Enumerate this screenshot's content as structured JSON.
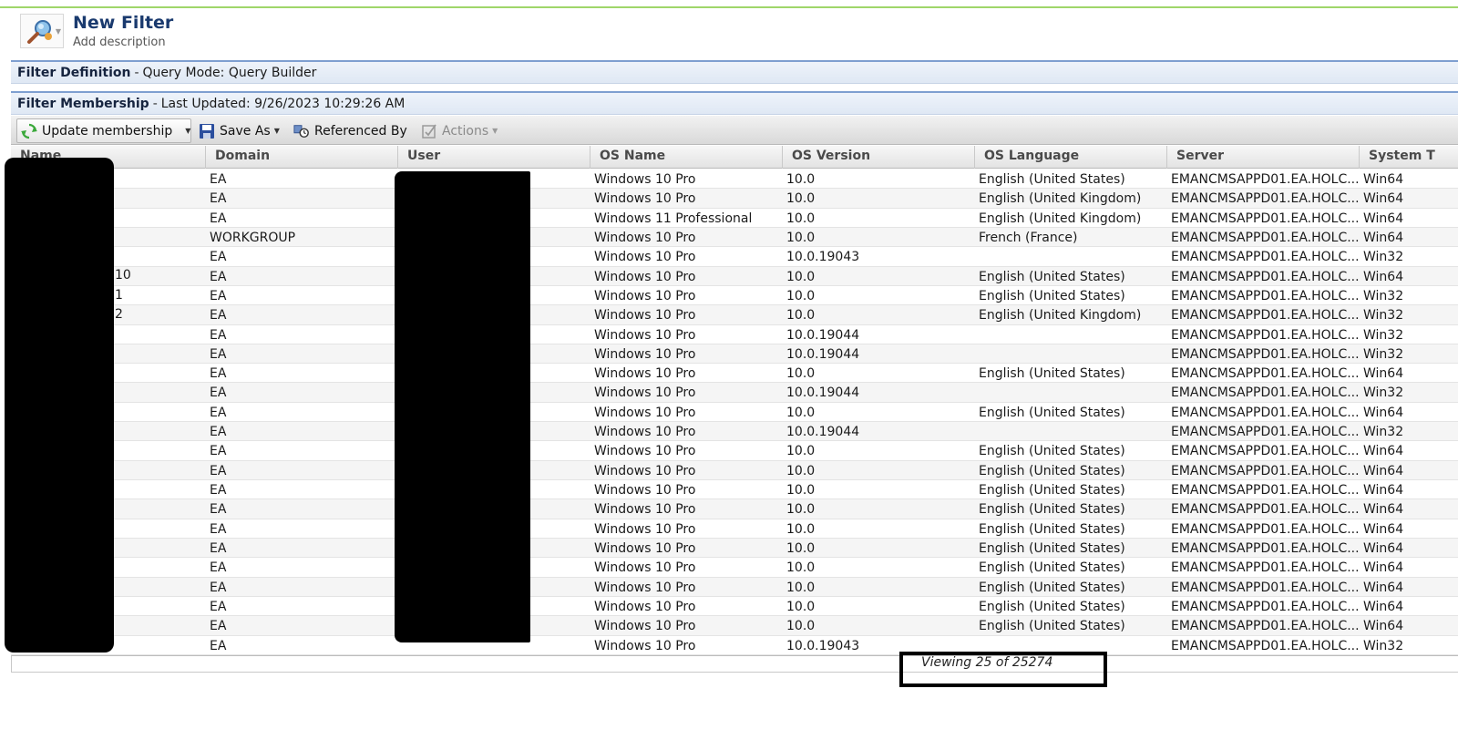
{
  "header": {
    "title": "New Filter",
    "subtitle": "Add description"
  },
  "definition_bar": {
    "label": "Filter Definition",
    "separator": "-",
    "detail": "Query Mode: Query Builder"
  },
  "membership_bar": {
    "label": "Filter Membership",
    "separator": "-",
    "detail": "Last Updated: 9/26/2023 10:29:26 AM"
  },
  "toolbar": {
    "update_label": "Update membership",
    "save_as_label": "Save As",
    "referenced_by_label": "Referenced By",
    "actions_label": "Actions"
  },
  "columns": [
    "Name",
    "Domain",
    "User",
    "OS Name",
    "OS Version",
    "OS Language",
    "Server",
    "System T"
  ],
  "name_fragments": [
    "10",
    "1",
    "2"
  ],
  "rows": [
    {
      "domain": "EA",
      "os_name": "Windows 10 Pro",
      "os_version": "10.0",
      "os_language": "English (United States)",
      "server": "EMANCMSAPPD01.EA.HOLC...",
      "system_type": "Win64"
    },
    {
      "domain": "EA",
      "os_name": "Windows 10 Pro",
      "os_version": "10.0",
      "os_language": "English (United Kingdom)",
      "server": "EMANCMSAPPD01.EA.HOLC...",
      "system_type": "Win64"
    },
    {
      "domain": "EA",
      "os_name": "Windows 11 Professional",
      "os_version": "10.0",
      "os_language": "English (United Kingdom)",
      "server": "EMANCMSAPPD01.EA.HOLC...",
      "system_type": "Win64"
    },
    {
      "domain": "WORKGROUP",
      "os_name": "Windows 10 Pro",
      "os_version": "10.0",
      "os_language": "French (France)",
      "server": "EMANCMSAPPD01.EA.HOLC...",
      "system_type": "Win64"
    },
    {
      "domain": "EA",
      "os_name": "Windows 10 Pro",
      "os_version": "10.0.19043",
      "os_language": "",
      "server": "EMANCMSAPPD01.EA.HOLC...",
      "system_type": "Win32"
    },
    {
      "domain": "EA",
      "os_name": "Windows 10 Pro",
      "os_version": "10.0",
      "os_language": "English (United States)",
      "server": "EMANCMSAPPD01.EA.HOLC...",
      "system_type": "Win64"
    },
    {
      "domain": "EA",
      "os_name": "Windows 10 Pro",
      "os_version": "10.0",
      "os_language": "English (United States)",
      "server": "EMANCMSAPPD01.EA.HOLC...",
      "system_type": "Win32"
    },
    {
      "domain": "EA",
      "os_name": "Windows 10 Pro",
      "os_version": "10.0",
      "os_language": "English (United Kingdom)",
      "server": "EMANCMSAPPD01.EA.HOLC...",
      "system_type": "Win32"
    },
    {
      "domain": "EA",
      "os_name": "Windows 10 Pro",
      "os_version": "10.0.19044",
      "os_language": "",
      "server": "EMANCMSAPPD01.EA.HOLC...",
      "system_type": "Win32"
    },
    {
      "domain": "EA",
      "os_name": "Windows 10 Pro",
      "os_version": "10.0.19044",
      "os_language": "",
      "server": "EMANCMSAPPD01.EA.HOLC...",
      "system_type": "Win32"
    },
    {
      "domain": "EA",
      "os_name": "Windows 10 Pro",
      "os_version": "10.0",
      "os_language": "English (United States)",
      "server": "EMANCMSAPPD01.EA.HOLC...",
      "system_type": "Win64"
    },
    {
      "domain": "EA",
      "os_name": "Windows 10 Pro",
      "os_version": "10.0.19044",
      "os_language": "",
      "server": "EMANCMSAPPD01.EA.HOLC...",
      "system_type": "Win32"
    },
    {
      "domain": "EA",
      "os_name": "Windows 10 Pro",
      "os_version": "10.0",
      "os_language": "English (United States)",
      "server": "EMANCMSAPPD01.EA.HOLC...",
      "system_type": "Win64"
    },
    {
      "domain": "EA",
      "os_name": "Windows 10 Pro",
      "os_version": "10.0.19044",
      "os_language": "",
      "server": "EMANCMSAPPD01.EA.HOLC...",
      "system_type": "Win32"
    },
    {
      "domain": "EA",
      "os_name": "Windows 10 Pro",
      "os_version": "10.0",
      "os_language": "English (United States)",
      "server": "EMANCMSAPPD01.EA.HOLC...",
      "system_type": "Win64"
    },
    {
      "domain": "EA",
      "os_name": "Windows 10 Pro",
      "os_version": "10.0",
      "os_language": "English (United States)",
      "server": "EMANCMSAPPD01.EA.HOLC...",
      "system_type": "Win64"
    },
    {
      "domain": "EA",
      "os_name": "Windows 10 Pro",
      "os_version": "10.0",
      "os_language": "English (United States)",
      "server": "EMANCMSAPPD01.EA.HOLC...",
      "system_type": "Win64"
    },
    {
      "domain": "EA",
      "os_name": "Windows 10 Pro",
      "os_version": "10.0",
      "os_language": "English (United States)",
      "server": "EMANCMSAPPD01.EA.HOLC...",
      "system_type": "Win64"
    },
    {
      "domain": "EA",
      "os_name": "Windows 10 Pro",
      "os_version": "10.0",
      "os_language": "English (United States)",
      "server": "EMANCMSAPPD01.EA.HOLC...",
      "system_type": "Win64"
    },
    {
      "domain": "EA",
      "os_name": "Windows 10 Pro",
      "os_version": "10.0",
      "os_language": "English (United States)",
      "server": "EMANCMSAPPD01.EA.HOLC...",
      "system_type": "Win64"
    },
    {
      "domain": "EA",
      "os_name": "Windows 10 Pro",
      "os_version": "10.0",
      "os_language": "English (United States)",
      "server": "EMANCMSAPPD01.EA.HOLC...",
      "system_type": "Win64"
    },
    {
      "domain": "EA",
      "os_name": "Windows 10 Pro",
      "os_version": "10.0",
      "os_language": "English (United States)",
      "server": "EMANCMSAPPD01.EA.HOLC...",
      "system_type": "Win64"
    },
    {
      "domain": "EA",
      "os_name": "Windows 10 Pro",
      "os_version": "10.0",
      "os_language": "English (United States)",
      "server": "EMANCMSAPPD01.EA.HOLC...",
      "system_type": "Win64"
    },
    {
      "domain": "EA",
      "os_name": "Windows 10 Pro",
      "os_version": "10.0",
      "os_language": "English (United States)",
      "server": "EMANCMSAPPD01.EA.HOLC...",
      "system_type": "Win64"
    },
    {
      "domain": "EA",
      "os_name": "Windows 10 Pro",
      "os_version": "10.0.19043",
      "os_language": "",
      "server": "EMANCMSAPPD01.EA.HOLC...",
      "system_type": "Win32"
    }
  ],
  "footer": {
    "viewing_text": "Viewing 25 of 25274"
  },
  "colors": {
    "title": "#1a3a6e",
    "section_accent": "#7e9fd0",
    "top_accent": "#9fd66a",
    "redaction": "#000000"
  }
}
